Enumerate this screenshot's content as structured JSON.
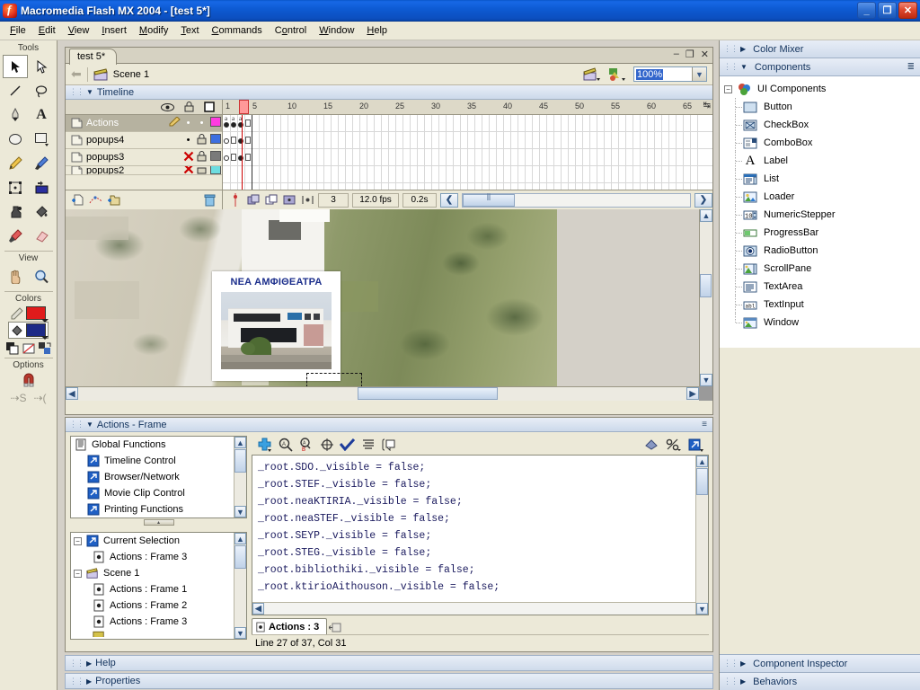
{
  "window": {
    "title": "Macromedia Flash MX 2004 - [test 5*]",
    "app_icon": "flash-icon",
    "minimize": "_",
    "maximize": "❐",
    "close": "✕"
  },
  "menubar": {
    "items": [
      {
        "label": "File"
      },
      {
        "label": "Edit"
      },
      {
        "label": "View"
      },
      {
        "label": "Insert"
      },
      {
        "label": "Modify"
      },
      {
        "label": "Text"
      },
      {
        "label": "Commands"
      },
      {
        "label": "Control"
      },
      {
        "label": "Window"
      },
      {
        "label": "Help"
      }
    ]
  },
  "tools": {
    "header": "Tools",
    "view_label": "View",
    "colors_label": "Colors",
    "options_label": "Options",
    "items": [
      {
        "name": "selection-tool",
        "selected": true
      },
      {
        "name": "subselection-tool",
        "selected": false
      },
      {
        "name": "line-tool",
        "selected": false
      },
      {
        "name": "lasso-tool",
        "selected": false
      },
      {
        "name": "pen-tool",
        "selected": false
      },
      {
        "name": "text-tool",
        "selected": false
      },
      {
        "name": "oval-tool",
        "selected": false
      },
      {
        "name": "rectangle-tool",
        "selected": false
      },
      {
        "name": "pencil-tool",
        "selected": false
      },
      {
        "name": "brush-tool",
        "selected": false
      },
      {
        "name": "free-transform-tool",
        "selected": false
      },
      {
        "name": "fill-transform-tool",
        "selected": false
      },
      {
        "name": "ink-bottle-tool",
        "selected": false
      },
      {
        "name": "paint-bucket-tool",
        "selected": false
      },
      {
        "name": "eyedropper-tool",
        "selected": false
      },
      {
        "name": "eraser-tool",
        "selected": false
      }
    ],
    "view_items": [
      {
        "name": "hand-tool"
      },
      {
        "name": "zoom-tool"
      }
    ],
    "colors": {
      "stroke_color": "#e01b1b",
      "fill_color": "#1d2a86"
    },
    "color_mini": [
      {
        "name": "black-and-white-icon"
      },
      {
        "name": "no-color-icon"
      },
      {
        "name": "swap-colors-icon"
      }
    ],
    "options": [
      {
        "name": "snap-to-objects-icon"
      },
      {
        "name": "smooth-icon"
      },
      {
        "name": "straighten-icon"
      }
    ]
  },
  "document": {
    "tab_label": "test 5*",
    "minimize": "–",
    "restore": "❐",
    "close": "✕",
    "scene_label": "Scene 1",
    "scene_icon": "clapperboard-icon",
    "back_arrow": "⬅",
    "edit_scene_icon": "edit-scene-icon",
    "edit_symbols_icon": "edit-symbols-icon",
    "zoom_value": "100%"
  },
  "timeline": {
    "title": "Timeline",
    "column_icons": [
      "eye-icon",
      "lock-icon",
      "outline-icon"
    ],
    "layers": [
      {
        "name": "Actions",
        "active": true,
        "pencil": true,
        "visible_dot": "•",
        "lock_dot": "•",
        "color": "#ff3ce0"
      },
      {
        "name": "popups4",
        "active": false,
        "pencil": false,
        "visible_dot": "•",
        "lock_state": "locked",
        "color": "#3d6fe0"
      },
      {
        "name": "popups3",
        "active": false,
        "pencil": false,
        "visible_state": "hidden",
        "lock_state": "locked",
        "color": "#7a7a7a"
      },
      {
        "name": "popups2",
        "active": false,
        "pencil": false,
        "visible_state": "hidden",
        "lock_state": "locked",
        "color": "#6ddde0"
      }
    ],
    "ruler_ticks": [
      "1",
      "5",
      "10",
      "15",
      "20",
      "25",
      "30",
      "35",
      "40",
      "45",
      "50",
      "55",
      "60",
      "65"
    ],
    "playhead_frame": 3,
    "footer": {
      "new_layer_icon": "new-layer-icon",
      "add_motion_guide_icon": "add-motion-guide-icon",
      "new_folder_icon": "new-folder-icon",
      "delete_layer_icon": "trash-icon",
      "onion_skin_icon": "onion-skin-icon",
      "onion_outline_icon": "onion-skin-outline-icon",
      "edit_multiple_icon": "edit-multiple-frames-icon",
      "modify_markers_icon": "modify-onion-markers-icon",
      "current_frame": "3",
      "frame_rate": "12.0 fps",
      "elapsed_time": "0.2s",
      "scroll_left": "❮",
      "scroll_right": "❯"
    }
  },
  "stage": {
    "popup": {
      "title": "ΝΕΑ ΑΜΦΙΘΕΑΤΡΑ",
      "photo_name": "amphitheatre-building-photo"
    },
    "background_name": "aerial-satellite-map"
  },
  "actions_panel": {
    "title": "Actions - Frame",
    "toolbar": [
      {
        "name": "add-item-icon",
        "glyph": "✚"
      },
      {
        "name": "find-icon",
        "glyph": "⌕"
      },
      {
        "name": "find-replace-icon",
        "glyph": "⌕"
      },
      {
        "name": "insert-target-path-icon",
        "glyph": "⊕"
      },
      {
        "name": "check-syntax-icon",
        "glyph": "✔"
      },
      {
        "name": "auto-format-icon",
        "glyph": "▤"
      },
      {
        "name": "show-code-hint-icon",
        "glyph": "▢"
      }
    ],
    "toolbar_right": [
      {
        "name": "debug-options-icon",
        "glyph": "◈"
      },
      {
        "name": "view-options-icon",
        "glyph": "%"
      },
      {
        "name": "script-assist-icon",
        "glyph": "↗"
      }
    ],
    "toolbox_tree": [
      {
        "label": "Global Functions",
        "icon": "book-icon",
        "level": 0
      },
      {
        "label": "Timeline Control",
        "icon": "arrow-folder-icon",
        "level": 1
      },
      {
        "label": "Browser/Network",
        "icon": "arrow-folder-icon",
        "level": 1
      },
      {
        "label": "Movie Clip Control",
        "icon": "arrow-folder-icon",
        "level": 1
      },
      {
        "label": "Printing Functions",
        "icon": "arrow-folder-icon",
        "level": 1
      }
    ],
    "script_navigator": [
      {
        "label": "Current Selection",
        "icon": "arrow-folder-icon",
        "level": 0,
        "expander": "−"
      },
      {
        "label": "Actions : Frame 3",
        "icon": "frame-icon",
        "level": 1
      },
      {
        "label": "Scene 1",
        "icon": "clapperboard-icon",
        "level": 0,
        "expander": "−"
      },
      {
        "label": "Actions : Frame 1",
        "icon": "frame-icon",
        "level": 1
      },
      {
        "label": "Actions : Frame 2",
        "icon": "frame-icon",
        "level": 1
      },
      {
        "label": "Actions : Frame 3",
        "icon": "frame-icon",
        "level": 1
      }
    ],
    "code": [
      "_root.SDO._visible = false;",
      "_root.STEF._visible = false;",
      "_root.neaKTIRIA._visible = false;",
      "_root.neaSTEF._visible = false;",
      "_root.SEYP._visible = false;",
      "_root.STEG._visible = false;",
      "_root.bibliothiki._visible = false;",
      "_root.ktirioAithouson._visible = false;"
    ],
    "tab_label": "Actions : 3",
    "tab_icon": "frame-icon",
    "pin_icon": "pin-script-icon",
    "status": "Line 27 of 37, Col 31"
  },
  "bottom_panels": [
    {
      "label": "Help",
      "collapsed": true
    },
    {
      "label": "Properties",
      "collapsed": true
    }
  ],
  "right_dock": {
    "color_mixer": {
      "label": "Color Mixer",
      "collapsed": true,
      "tri": "▶"
    },
    "components": {
      "label": "Components",
      "tri": "▼",
      "root": {
        "label": "UI Components",
        "icon": "components-icon",
        "expander": "−"
      },
      "items": [
        {
          "label": "Button",
          "icon": "button-component-icon"
        },
        {
          "label": "CheckBox",
          "icon": "checkbox-component-icon"
        },
        {
          "label": "ComboBox",
          "icon": "combobox-component-icon"
        },
        {
          "label": "Label",
          "icon": "label-component-icon"
        },
        {
          "label": "List",
          "icon": "list-component-icon"
        },
        {
          "label": "Loader",
          "icon": "loader-component-icon"
        },
        {
          "label": "NumericStepper",
          "icon": "numericstepper-component-icon"
        },
        {
          "label": "ProgressBar",
          "icon": "progressbar-component-icon"
        },
        {
          "label": "RadioButton",
          "icon": "radiobutton-component-icon"
        },
        {
          "label": "ScrollPane",
          "icon": "scrollpane-component-icon"
        },
        {
          "label": "TextArea",
          "icon": "textarea-component-icon"
        },
        {
          "label": "TextInput",
          "icon": "textinput-component-icon"
        },
        {
          "label": "Window",
          "icon": "window-component-icon"
        }
      ]
    },
    "bottom_bars": [
      {
        "label": "Component Inspector",
        "tri": "▶"
      },
      {
        "label": "Behaviors",
        "tri": "▶"
      }
    ]
  },
  "colors": {
    "titlebar_blue": "#0d5ad2",
    "panel_beige": "#ece9d8",
    "panel_header_blue": "#cfdbeb",
    "code_text": "#1a1a5e",
    "popup_title": "#1c2f8c"
  }
}
